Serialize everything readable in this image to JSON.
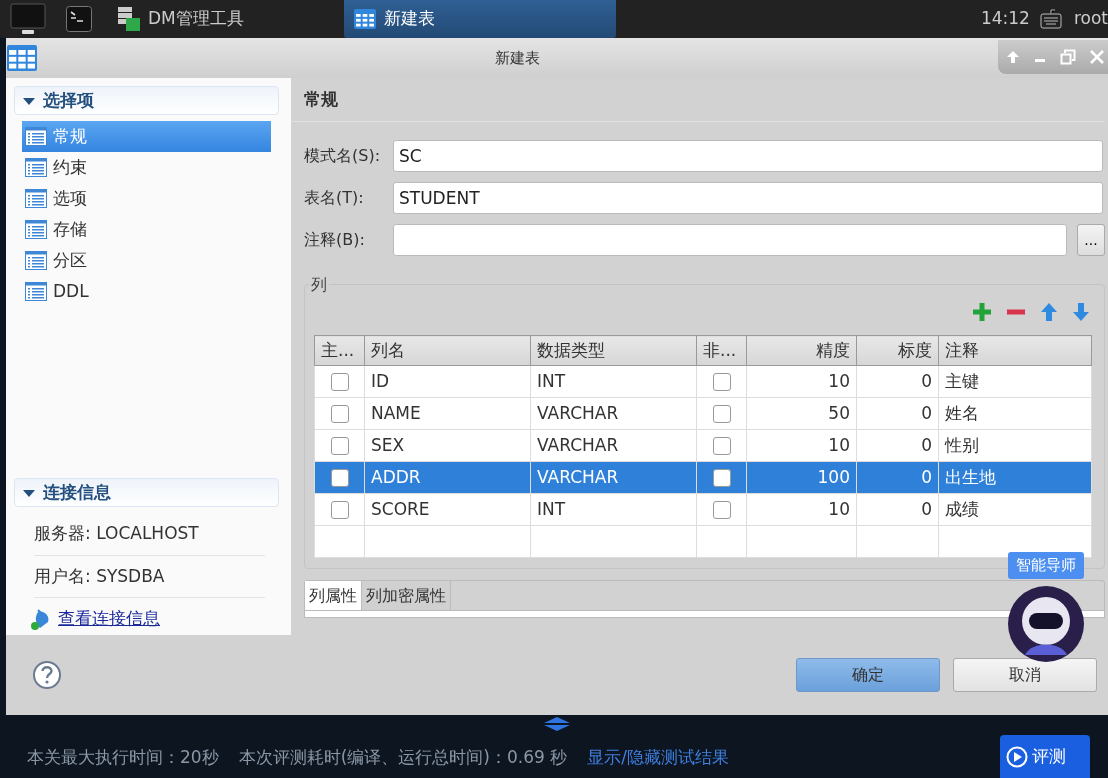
{
  "taskbar": {
    "tasks": [
      {
        "label": "DM管理工具",
        "selected": false
      },
      {
        "label": "新建表",
        "selected": true
      }
    ],
    "clock": "14:12",
    "user": "root"
  },
  "dialog": {
    "title": "新建表",
    "sidebar": {
      "title": "选择项",
      "expanded": true,
      "items": [
        {
          "label": "常规",
          "selected": true
        },
        {
          "label": "约束",
          "selected": false
        },
        {
          "label": "选项",
          "selected": false
        },
        {
          "label": "存储",
          "selected": false
        },
        {
          "label": "分区",
          "selected": false
        },
        {
          "label": "DDL",
          "selected": false
        }
      ],
      "connection": {
        "title": "连接信息",
        "expanded": true,
        "lines": [
          "服务器: LOCALHOST",
          "用户名: SYSDBA"
        ],
        "link": "查看连接信息"
      }
    },
    "page_title": "常规",
    "fields": [
      {
        "label": "模式名(S):",
        "value": "SC"
      },
      {
        "label": "表名(T):",
        "value": "STUDENT"
      },
      {
        "label": "注释(B):",
        "button": "..."
      }
    ],
    "columns_group": {
      "title": "列",
      "columns": [
        {
          "label": "主...",
          "kind": "check"
        },
        {
          "label": "列名",
          "kind": "text"
        },
        {
          "label": "数据类型",
          "kind": "text"
        },
        {
          "label": "非...",
          "kind": "check"
        },
        {
          "label": "精度",
          "kind": "number"
        },
        {
          "label": "标度",
          "kind": "number"
        },
        {
          "label": "注释",
          "kind": "text"
        }
      ],
      "rows": [
        {
          "selected": false,
          "cells": [
            {
              "checked": false
            },
            {
              "text": "ID"
            },
            {
              "text": "INT"
            },
            {
              "checked": false
            },
            {
              "text": "10"
            },
            {
              "text": "0"
            },
            {
              "text": "主键"
            }
          ]
        },
        {
          "selected": false,
          "cells": [
            {
              "checked": false
            },
            {
              "text": "NAME"
            },
            {
              "text": "VARCHAR"
            },
            {
              "checked": false
            },
            {
              "text": "50"
            },
            {
              "text": "0"
            },
            {
              "text": "姓名"
            }
          ]
        },
        {
          "selected": false,
          "cells": [
            {
              "checked": false
            },
            {
              "text": "SEX"
            },
            {
              "text": "VARCHAR"
            },
            {
              "checked": false
            },
            {
              "text": "10"
            },
            {
              "text": "0"
            },
            {
              "text": "性别"
            }
          ]
        },
        {
          "selected": true,
          "cells": [
            {
              "checked": false
            },
            {
              "text": "ADDR"
            },
            {
              "text": "VARCHAR"
            },
            {
              "checked": false
            },
            {
              "text": "100"
            },
            {
              "text": "0"
            },
            {
              "text": "出生地"
            }
          ]
        },
        {
          "selected": false,
          "cells": [
            {
              "checked": false
            },
            {
              "text": "SCORE"
            },
            {
              "text": "INT"
            },
            {
              "checked": false
            },
            {
              "text": "10"
            },
            {
              "text": "0"
            },
            {
              "text": "成绩"
            }
          ]
        }
      ]
    },
    "tabs": [
      {
        "label": "列属性",
        "selected": true
      },
      {
        "label": "列加密属性",
        "selected": false
      }
    ],
    "buttons": {
      "ok": "确定",
      "cancel": "取消"
    }
  },
  "assistant": {
    "label": "智能导师"
  },
  "bottom_bar": {
    "max_time": "本关最大执行时间：20秒",
    "elapsed": "本次评测耗时(编译、运行总时间)：0.69 秒",
    "toggle_link": "显示/隐藏测试结果",
    "run_button": "评测"
  }
}
